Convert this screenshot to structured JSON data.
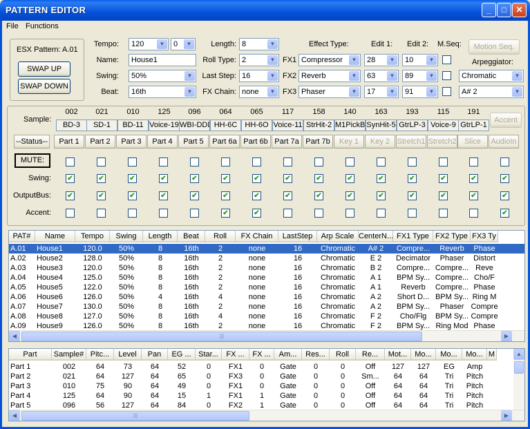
{
  "window": {
    "title": "PATTERN EDITOR"
  },
  "menu": [
    "File",
    "Functions"
  ],
  "pattern": {
    "label": "ESX Pattern: A.01",
    "swap_up": "SWAP UP",
    "swap_down": "SWAP DOWN"
  },
  "fields": {
    "tempo_label": "Tempo:",
    "tempo": "120",
    "tempo_frac": "0",
    "name_label": "Name:",
    "name": "House1",
    "swing_label": "Swing:",
    "swing": "50%",
    "beat_label": "Beat:",
    "beat": "16th",
    "length_label": "Length:",
    "length": "8",
    "roll_label": "Roll Type:",
    "roll": "2",
    "laststep_label": "Last Step:",
    "laststep": "16",
    "fxchain_label": "FX Chain:",
    "fxchain": "none"
  },
  "effects": {
    "type_label": "Effect Type:",
    "edit1_label": "Edit 1:",
    "edit2_label": "Edit 2:",
    "mseq_label": "M.Seq:",
    "rows": [
      {
        "label": "FX1",
        "type": "Compressor",
        "e1": "28",
        "e2": "10"
      },
      {
        "label": "FX2",
        "type": "Reverb",
        "e1": "63",
        "e2": "89"
      },
      {
        "label": "FX3",
        "type": "Phaser",
        "e1": "17",
        "e2": "91"
      }
    ]
  },
  "motion_seq_label": "Motion Seq.",
  "arpeggiator": {
    "label": "Arpeggiator:",
    "scale": "Chromatic",
    "note": "A# 2"
  },
  "sample_label": "Sample:",
  "sample_numbers": [
    "002",
    "021",
    "010",
    "125",
    "096",
    "064",
    "065",
    "117",
    "158",
    "140",
    "163",
    "193",
    "115",
    "191"
  ],
  "sample_names": [
    "BD-3",
    "SD-1",
    "BD-11",
    "Voice-19",
    "WBI-DDD",
    "HH-6C",
    "HH-6O",
    "Voice-11",
    "StrHit-2",
    "M1PickBs",
    "SynHit-5",
    "GtrLP-3",
    "Voice-9",
    "GtrLP-1"
  ],
  "accent_button": "Accent",
  "status_button": "--Status--",
  "parts": [
    "Part 1",
    "Part 2",
    "Part 3",
    "Part 4",
    "Part 5",
    "Part 6a",
    "Part 6b",
    "Part 7a",
    "Part 7b",
    "Key 1",
    "Key 2",
    "Stretch1",
    "Stretch2",
    "Slice",
    "AudioIn"
  ],
  "mute_label": "MUTE:",
  "swing_row_label": "Swing:",
  "outputbus_label": "OutputBus:",
  "accent_row_label": "Accent:",
  "mute_checks": [
    0,
    0,
    0,
    0,
    0,
    0,
    0,
    0,
    0,
    0,
    0,
    0,
    0,
    0,
    0
  ],
  "swing_checks": [
    1,
    1,
    1,
    1,
    1,
    1,
    1,
    1,
    1,
    1,
    1,
    1,
    1,
    1,
    1
  ],
  "output_checks": [
    1,
    1,
    1,
    1,
    1,
    1,
    1,
    1,
    1,
    1,
    1,
    1,
    1,
    1,
    1
  ],
  "accent_checks": [
    0,
    0,
    0,
    0,
    0,
    1,
    1,
    0,
    0,
    0,
    0,
    0,
    0,
    0,
    1
  ],
  "patterns": {
    "columns": [
      "PAT#",
      "Name",
      "Tempo",
      "Swing",
      "Length",
      "Beat",
      "Roll",
      "FX Chain",
      "LastStep",
      "Arp Scale",
      "CenterN...",
      "FX1 Type",
      "FX2 Type",
      "FX3 Ty"
    ],
    "rows": [
      [
        "A.01",
        "House1",
        "120.0",
        "50%",
        "8",
        "16th",
        "2",
        "none",
        "16",
        "Chromatic",
        "A# 2",
        "Compre...",
        "Reverb",
        "Phase"
      ],
      [
        "A.02",
        "House2",
        "128.0",
        "50%",
        "8",
        "16th",
        "2",
        "none",
        "16",
        "Chromatic",
        "E 2",
        "Decimator",
        "Phaser",
        "Distort"
      ],
      [
        "A.03",
        "House3",
        "120.0",
        "50%",
        "8",
        "16th",
        "2",
        "none",
        "16",
        "Chromatic",
        "B 2",
        "Compre...",
        "Compre...",
        "Reve"
      ],
      [
        "A.04",
        "House4",
        "125.0",
        "50%",
        "8",
        "16th",
        "2",
        "none",
        "16",
        "Chromatic",
        "A 1",
        "BPM Sy...",
        "Compre...",
        "Cho/F"
      ],
      [
        "A.05",
        "House5",
        "122.0",
        "50%",
        "8",
        "16th",
        "2",
        "none",
        "16",
        "Chromatic",
        "A 1",
        "Reverb",
        "Compre...",
        "Phase"
      ],
      [
        "A.06",
        "House6",
        "126.0",
        "50%",
        "4",
        "16th",
        "4",
        "none",
        "16",
        "Chromatic",
        "A 2",
        "Short D...",
        "BPM Sy...",
        "Ring M"
      ],
      [
        "A.07",
        "House7",
        "130.0",
        "50%",
        "8",
        "16th",
        "2",
        "none",
        "16",
        "Chromatic",
        "A 2",
        "BPM Sy...",
        "Phaser",
        "Compre"
      ],
      [
        "A.08",
        "House8",
        "127.0",
        "50%",
        "8",
        "16th",
        "4",
        "none",
        "16",
        "Chromatic",
        "F 2",
        "Cho/Flg",
        "BPM Sy...",
        "Compre"
      ],
      [
        "A.09",
        "House9",
        "126.0",
        "50%",
        "8",
        "16th",
        "2",
        "none",
        "16",
        "Chromatic",
        "F 2",
        "BPM Sy...",
        "Ring Mod",
        "Phase"
      ]
    ]
  },
  "parts_table": {
    "columns": [
      "Part",
      "Sample#",
      "Pitc...",
      "Level",
      "Pan",
      "EG ...",
      "Star...",
      "FX ...",
      "FX ...",
      "Am...",
      "Res...",
      "Roll",
      "Re...",
      "Mot...",
      "Mo...",
      "Mo...",
      "Mo...",
      "M"
    ],
    "rows": [
      [
        "Part 1",
        "002",
        "64",
        "73",
        "64",
        "52",
        "0",
        "FX1",
        "0",
        "Gate",
        "0",
        "0",
        "Off",
        "127",
        "127",
        "EG",
        "Amp"
      ],
      [
        "Part 2",
        "021",
        "64",
        "127",
        "64",
        "65",
        "0",
        "FX3",
        "0",
        "Gate",
        "0",
        "0",
        "Sm...",
        "64",
        "64",
        "Tri",
        "Pitch"
      ],
      [
        "Part 3",
        "010",
        "75",
        "90",
        "64",
        "49",
        "0",
        "FX1",
        "0",
        "Gate",
        "0",
        "0",
        "Off",
        "64",
        "64",
        "Tri",
        "Pitch"
      ],
      [
        "Part 4",
        "125",
        "64",
        "90",
        "64",
        "15",
        "1",
        "FX1",
        "1",
        "Gate",
        "0",
        "0",
        "Off",
        "64",
        "64",
        "Tri",
        "Pitch"
      ],
      [
        "Part 5",
        "096",
        "56",
        "127",
        "64",
        "84",
        "0",
        "FX2",
        "1",
        "Gate",
        "0",
        "0",
        "Off",
        "64",
        "64",
        "Tri",
        "Pitch"
      ]
    ]
  },
  "colors": {
    "title_bar": "#0551d8",
    "selection": "#316ac5",
    "checkmark": "#21a121"
  }
}
